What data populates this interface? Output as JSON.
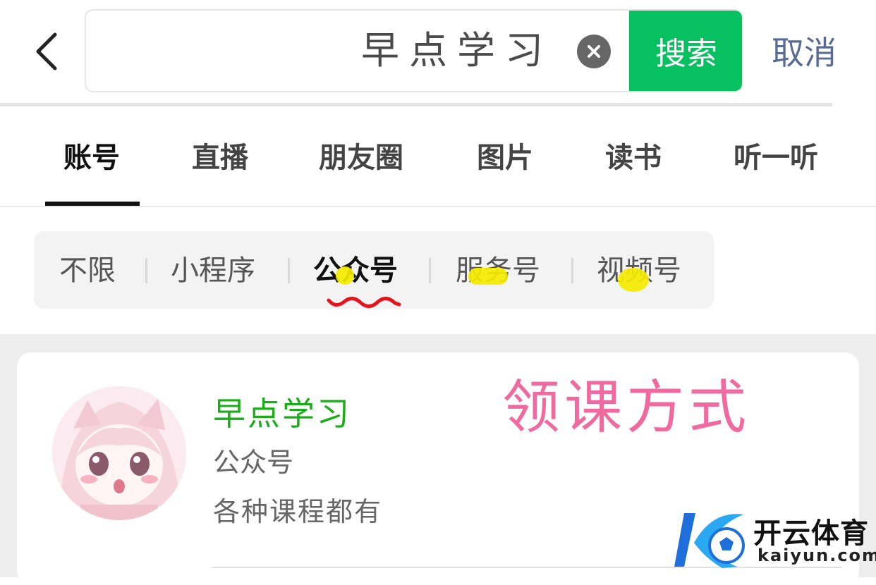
{
  "header": {
    "back_icon": "chevron-left-icon",
    "search_value": "早点学习",
    "clear_icon": "close-circle-icon",
    "search_label": "搜索",
    "cancel_label": "取消",
    "search_button_color": "#07c160",
    "cancel_color": "#576b95"
  },
  "tabs": [
    {
      "label": "账号",
      "active": true
    },
    {
      "label": "直播",
      "active": false
    },
    {
      "label": "朋友圈",
      "active": false
    },
    {
      "label": "图片",
      "active": false
    },
    {
      "label": "读书",
      "active": false
    },
    {
      "label": "听一听",
      "active": false
    }
  ],
  "filters": [
    {
      "label": "不限",
      "active": false
    },
    {
      "label": "小程序",
      "active": false
    },
    {
      "label": "公众号",
      "active": true
    },
    {
      "label": "服务号",
      "active": false
    },
    {
      "label": "视频号",
      "active": false
    }
  ],
  "result": {
    "name": "早点学习",
    "type": "公众号",
    "description": "各种课程都有",
    "name_color": "#1aad19"
  },
  "annotation": {
    "text": "领课方式",
    "color": "#f06aa0"
  },
  "watermark": {
    "name_cn": "开云体育",
    "name_en": "kaiyun.com"
  }
}
